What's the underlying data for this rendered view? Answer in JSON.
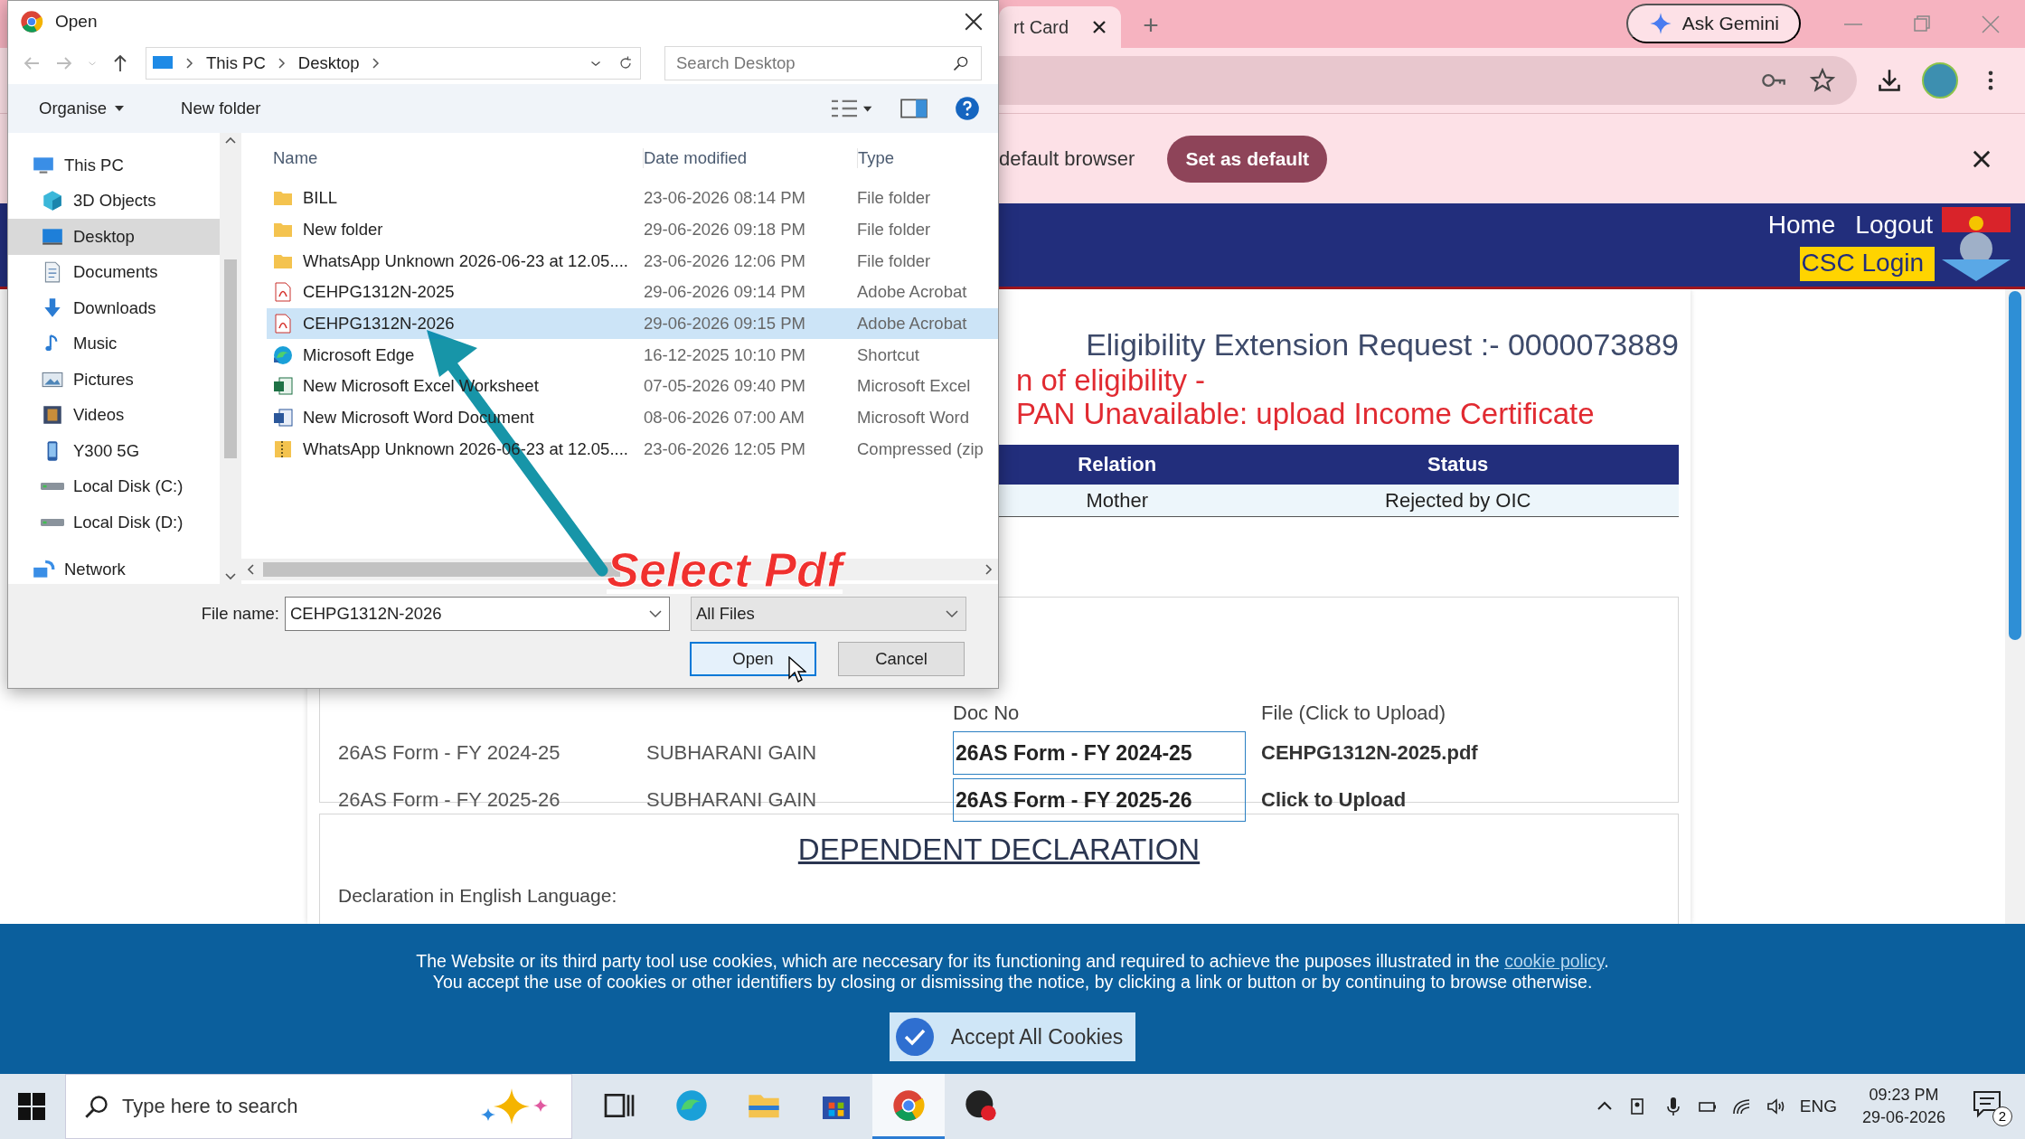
{
  "browser": {
    "tabs": [
      {
        "title": "rt Card",
        "selected": true
      }
    ],
    "new_tab": "+",
    "ask_gemini": "Ask Gemini",
    "infobar": {
      "text": "default browser",
      "button": "Set as default"
    }
  },
  "site": {
    "nav": [
      "Home",
      "Logout"
    ],
    "csc_login": "CSC Login",
    "title": "Eligibility Extension Request :- 0000073889",
    "notices": [
      "n of eligibility -",
      "PAN Unavailable: upload Income Certificate"
    ],
    "dependents_table": {
      "columns": [
        "Relation",
        "Status"
      ],
      "rows": [
        [
          "Mother",
          "Rejected by OIC"
        ]
      ]
    },
    "documents": {
      "columns": [
        "Doc No",
        "File (Click to Upload)"
      ],
      "rows": [
        {
          "doc_desc": "26AS Form - FY 2024-25",
          "beneficiary": "SUBHARANI GAIN",
          "doc_no": "26AS Form - FY 2024-25",
          "file": "CEHPG1312N-2025.pdf"
        },
        {
          "doc_desc": "26AS Form - FY 2025-26",
          "beneficiary": "SUBHARANI GAIN",
          "doc_no": "26AS Form - FY 2025-26",
          "file": "Click to Upload"
        }
      ]
    },
    "declaration": {
      "heading": "DEPENDENT DECLARATION",
      "label": "Declaration in English Language:"
    }
  },
  "dialog": {
    "title": "Open",
    "path": [
      "This PC",
      "Desktop"
    ],
    "search_placeholder": "Search Desktop",
    "toolbar": [
      {
        "label": "Organise",
        "dropdown": true
      },
      {
        "label": "New folder",
        "dropdown": false
      }
    ],
    "nav_pane": [
      {
        "label": "This PC",
        "kind": "pc",
        "selected": false
      },
      {
        "label": "3D Objects",
        "kind": "objects",
        "selected": false
      },
      {
        "label": "Desktop",
        "kind": "desktop",
        "selected": true
      },
      {
        "label": "Documents",
        "kind": "documents",
        "selected": false
      },
      {
        "label": "Downloads",
        "kind": "downloads",
        "selected": false
      },
      {
        "label": "Music",
        "kind": "music",
        "selected": false
      },
      {
        "label": "Pictures",
        "kind": "pictures",
        "selected": false
      },
      {
        "label": "Videos",
        "kind": "videos",
        "selected": false
      },
      {
        "label": "Y300 5G",
        "kind": "phone",
        "selected": false
      },
      {
        "label": "Local Disk (C:)",
        "kind": "disk",
        "selected": false
      },
      {
        "label": "Local Disk (D:)",
        "kind": "disk",
        "selected": false
      },
      {
        "label": "Network",
        "kind": "network",
        "selected": false
      }
    ],
    "columns": [
      "Name",
      "Date modified",
      "Type"
    ],
    "files": [
      {
        "name": "BILL",
        "date": "23-06-2026 08:14 PM",
        "type": "File folder",
        "kind": "folder",
        "selected": false
      },
      {
        "name": "New folder",
        "date": "29-06-2026 09:18 PM",
        "type": "File folder",
        "kind": "folder",
        "selected": false
      },
      {
        "name": "WhatsApp Unknown 2026-06-23 at 12.05....",
        "date": "23-06-2026 12:06 PM",
        "type": "File folder",
        "kind": "folder",
        "selected": false
      },
      {
        "name": "CEHPG1312N-2025",
        "date": "29-06-2026 09:14 PM",
        "type": "Adobe Acrobat",
        "kind": "pdf",
        "selected": false
      },
      {
        "name": "CEHPG1312N-2026",
        "date": "29-06-2026 09:15 PM",
        "type": "Adobe Acrobat",
        "kind": "pdf",
        "selected": true
      },
      {
        "name": "Microsoft Edge",
        "date": "16-12-2025 10:10 PM",
        "type": "Shortcut",
        "kind": "edge",
        "selected": false
      },
      {
        "name": "New Microsoft Excel Worksheet",
        "date": "07-05-2026 09:40 PM",
        "type": "Microsoft Excel",
        "kind": "excel",
        "selected": false
      },
      {
        "name": "New Microsoft Word Document",
        "date": "08-06-2026 07:00 AM",
        "type": "Microsoft Word",
        "kind": "word",
        "selected": false
      },
      {
        "name": "WhatsApp Unknown 2026-06-23 at 12.05....",
        "date": "23-06-2026 12:05 PM",
        "type": "Compressed (zip",
        "kind": "zip",
        "selected": false
      }
    ],
    "file_name_label": "File name:",
    "file_name": "CEHPG1312N-2026",
    "file_type": "All Files",
    "buttons": [
      {
        "label": "Open",
        "default": true
      },
      {
        "label": "Cancel",
        "default": false
      }
    ]
  },
  "annotation": {
    "text": "Select Pdf"
  },
  "cookie_banner": {
    "line1": "The Website or its third party tool use cookies, which are neccesary for its functioning and required to achieve the puposes illustrated in the ",
    "link": "cookie policy",
    "line1_end": ".",
    "line2": "You accept the use of cookies or other identifiers by closing or dismissing the notice, by clicking a link or button or by continuing to browse otherwise.",
    "button": "Accept All Cookies"
  },
  "taskbar": {
    "search_placeholder": "Type here to search",
    "apps": [
      {
        "kind": "taskview",
        "selected": false
      },
      {
        "kind": "edge",
        "selected": false
      },
      {
        "kind": "explorer",
        "selected": false
      },
      {
        "kind": "store",
        "selected": false
      },
      {
        "kind": "chrome",
        "selected": true
      },
      {
        "kind": "recorder",
        "selected": false
      }
    ],
    "language": "ENG",
    "time": "09:23 PM",
    "date": "29-06-2026",
    "notifications": "2"
  }
}
